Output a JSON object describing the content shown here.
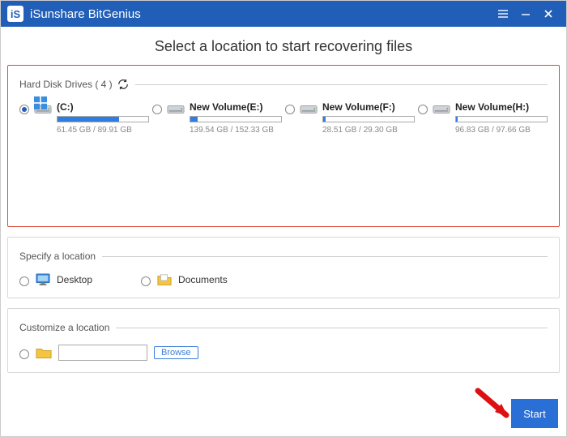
{
  "window": {
    "title": "iSunshare BitGenius"
  },
  "heading": "Select a location to start recovering files",
  "hdd": {
    "label": "Hard Disk Drives ( 4 )",
    "drives": [
      {
        "name": "(C:)",
        "size": "61.45 GB / 89.91 GB",
        "fill": 68,
        "selected": true,
        "os": true
      },
      {
        "name": "New Volume(E:)",
        "size": "139.54 GB / 152.33 GB",
        "fill": 8,
        "selected": false,
        "os": false
      },
      {
        "name": "New Volume(F:)",
        "size": "28.51 GB / 29.30 GB",
        "fill": 3,
        "selected": false,
        "os": false
      },
      {
        "name": "New Volume(H:)",
        "size": "96.83 GB / 97.66 GB",
        "fill": 2,
        "selected": false,
        "os": false
      }
    ]
  },
  "specify": {
    "label": "Specify a location",
    "items": [
      {
        "name": "Desktop"
      },
      {
        "name": "Documents"
      }
    ]
  },
  "customize": {
    "label": "Customize a location",
    "browse": "Browse",
    "path": ""
  },
  "start": "Start"
}
